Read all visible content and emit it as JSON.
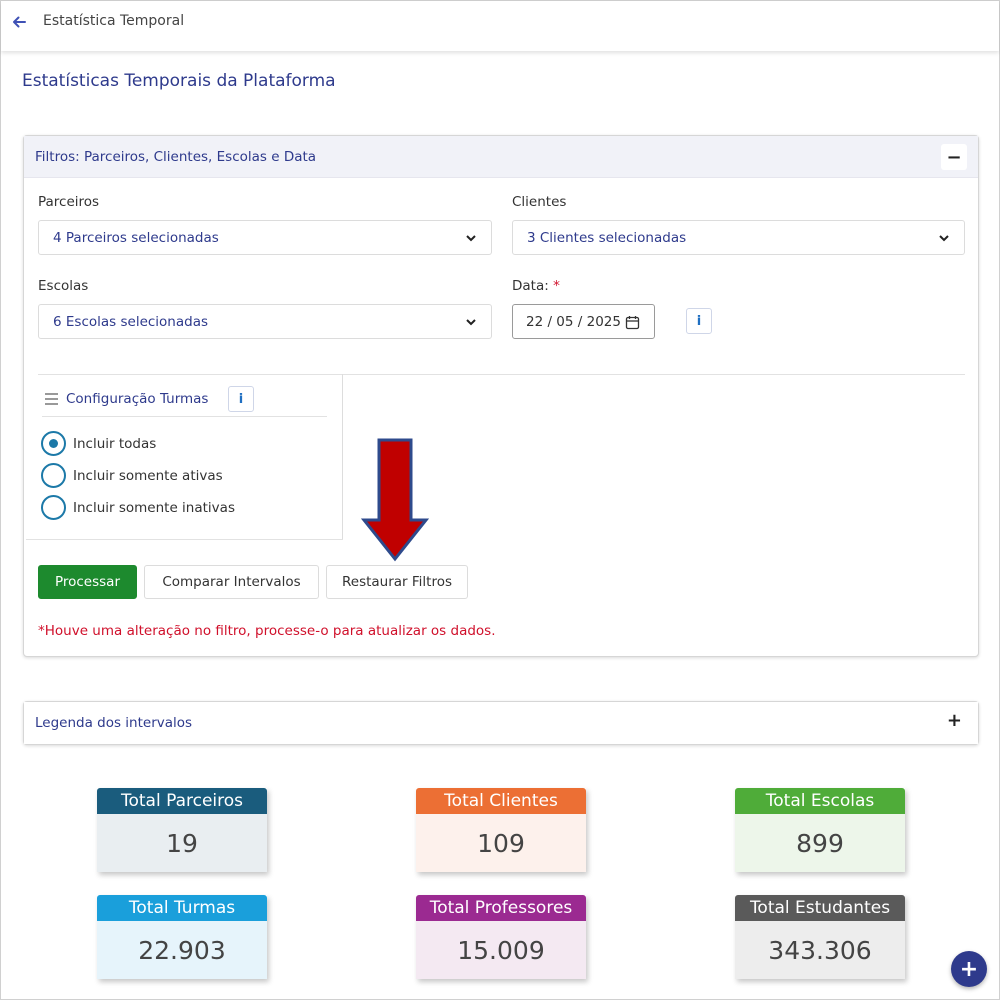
{
  "topbar": {
    "title": "Estatística Temporal"
  },
  "page": {
    "title": "Estatísticas Temporais da Plataforma"
  },
  "filters": {
    "header": "Filtros: Parceiros, Clientes, Escolas e Data",
    "collapse_symbol": "−",
    "parceiros": {
      "label": "Parceiros",
      "value": "4 Parceiros selecionadas"
    },
    "clientes": {
      "label": "Clientes",
      "value": "3 Clientes selecionadas"
    },
    "escolas": {
      "label": "Escolas",
      "value": "6 Escolas selecionadas"
    },
    "data": {
      "label": "Data:",
      "required_mark": "*",
      "value": "22 / 05 / 2025"
    },
    "info_symbol": "i"
  },
  "turmas": {
    "title": "Configuração Turmas",
    "info_symbol": "i",
    "options": [
      {
        "label": "Incluir todas",
        "selected": true
      },
      {
        "label": "Incluir somente ativas",
        "selected": false
      },
      {
        "label": "Incluir somente inativas",
        "selected": false
      }
    ]
  },
  "actions": {
    "process": "Processar",
    "compare": "Comparar Intervalos",
    "restore": "Restaurar Filtros"
  },
  "warning": "*Houve uma alteração no filtro, processe-o para atualizar os dados.",
  "legend": {
    "header": "Legenda dos intervalos",
    "expand_symbol": "+"
  },
  "stats": [
    {
      "label": "Total Parceiros",
      "value": "19",
      "head_color": "#1a5c7d",
      "body_color": "#e9eef1"
    },
    {
      "label": "Total Clientes",
      "value": "109",
      "head_color": "#ec6f34",
      "body_color": "#fdf1ec"
    },
    {
      "label": "Total Escolas",
      "value": "899",
      "head_color": "#4fac39",
      "body_color": "#edf6ea"
    },
    {
      "label": "Total Turmas",
      "value": "22.903",
      "head_color": "#1a9fdb",
      "body_color": "#e6f4fb"
    },
    {
      "label": "Total Professores",
      "value": "15.009",
      "head_color": "#9b2a91",
      "body_color": "#f4e9f2"
    },
    {
      "label": "Total Estudantes",
      "value": "343.306",
      "head_color": "#5a5a5a",
      "body_color": "#ededed"
    }
  ],
  "fab": {
    "symbol": "+"
  },
  "colors": {
    "accent": "#2e3a8c",
    "arrow_fill": "#c00000",
    "arrow_stroke": "#2e4a8c"
  }
}
